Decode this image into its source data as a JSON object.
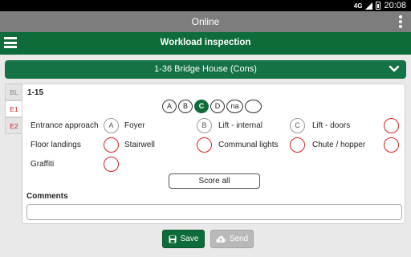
{
  "status_bar": {
    "network": "4G",
    "time": "20:08"
  },
  "window_title": "Online",
  "app_bar": {
    "title": "Workload inspection"
  },
  "location": {
    "selected": "1-36 Bridge House (Cons)"
  },
  "tabs": [
    {
      "label": "BL",
      "state": "inactive"
    },
    {
      "label": "E1",
      "state": "active"
    },
    {
      "label": "E2",
      "state": "inactive"
    }
  ],
  "panel": {
    "title": "1-15",
    "grades": [
      {
        "label": "A",
        "selected": false
      },
      {
        "label": "B",
        "selected": false
      },
      {
        "label": "C",
        "selected": true
      },
      {
        "label": "D",
        "selected": false
      },
      {
        "label": "na",
        "selected": false
      },
      {
        "label": "",
        "selected": false
      }
    ],
    "items": [
      {
        "label": "Entrance approach",
        "grade": "A"
      },
      {
        "label": "Foyer",
        "grade": "B"
      },
      {
        "label": "Lift - internal",
        "grade": "C"
      },
      {
        "label": "Lift - doors",
        "grade": ""
      },
      {
        "label": "Floor landings",
        "grade": ""
      },
      {
        "label": "Stairwell",
        "grade": ""
      },
      {
        "label": "Communal lights",
        "grade": ""
      },
      {
        "label": "Chute / hopper",
        "grade": ""
      },
      {
        "label": "Graffiti",
        "grade": ""
      }
    ],
    "score_all_label": "Score all",
    "comments_label": "Comments",
    "comments_value": ""
  },
  "buttons": {
    "save_label": "Save",
    "send_label": "Send"
  },
  "colors": {
    "primary_green": "#0e6b3a",
    "missing_red": "#d62020",
    "disabled_grey": "#b9b9b9"
  }
}
